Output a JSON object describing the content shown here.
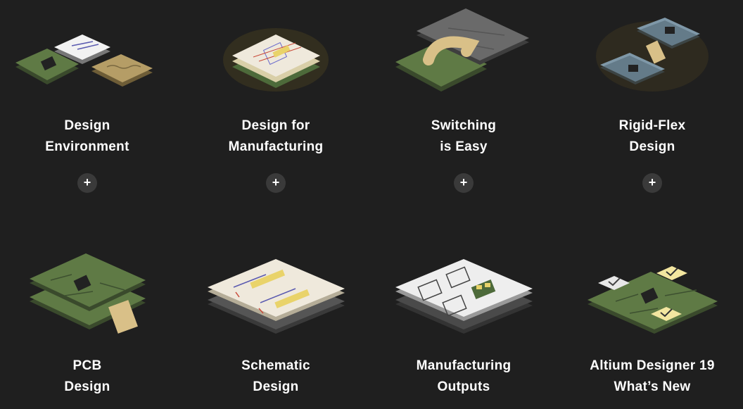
{
  "cards": [
    {
      "line1": "Design",
      "line2": "Environment",
      "expand": "+",
      "illustration": "three-board-icon"
    },
    {
      "line1": "Design for",
      "line2": "Manufacturing",
      "expand": "+",
      "illustration": "glowing-stack-icon"
    },
    {
      "line1": "Switching",
      "line2": "is Easy",
      "expand": "+",
      "illustration": "switch-arrow-icon"
    },
    {
      "line1": "Rigid-Flex",
      "line2": "Design",
      "expand": "+",
      "illustration": "rigid-flex-icon"
    },
    {
      "line1": "PCB",
      "line2": "Design",
      "illustration": "pcb-stack-icon"
    },
    {
      "line1": "Schematic",
      "line2": "Design",
      "illustration": "schematic-stack-icon"
    },
    {
      "line1": "Manufacturing",
      "line2": "Outputs",
      "illustration": "manufacturing-outputs-icon"
    },
    {
      "line1": "Altium Designer 19",
      "line2": "What’s New",
      "illustration": "whats-new-icon"
    }
  ],
  "colors": {
    "background": "#1f1f1f",
    "pcb_green": "#5f7a45",
    "paper": "#efe9dc",
    "flex_gold": "#d8c088",
    "rigid_blue": "#7f98a8",
    "check_yellow": "#f3e6a0"
  }
}
